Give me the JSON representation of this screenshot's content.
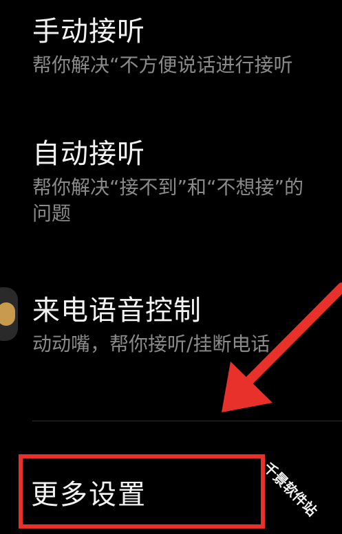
{
  "settings": {
    "manual": {
      "title": "手动接听",
      "desc_lines": [
        "帮你解决“不方便说话进行接听"
      ]
    },
    "auto": {
      "title": "自动接听",
      "desc_lines": [
        "帮你解决“接不到”和“不想接”的",
        "问题"
      ]
    },
    "voice": {
      "title": "来电语音控制",
      "desc_lines": [
        "动动嘴，帮你接听/挂断电话"
      ]
    }
  },
  "more": {
    "label": "更多设置"
  },
  "annotation": {
    "highlight_color": "#e8312a",
    "arrow_color": "#e8312a"
  },
  "watermark": {
    "text": "千景软件站"
  }
}
